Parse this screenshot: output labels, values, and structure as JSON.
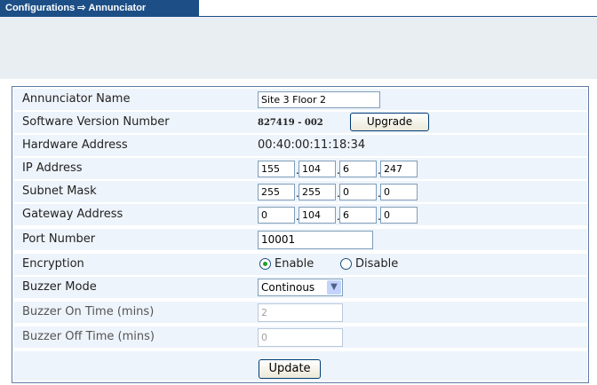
{
  "breadcrumb": {
    "section": "Configurations",
    "separator": "⇨",
    "page": "Annunciator"
  },
  "form": {
    "annunciator_name": {
      "label": "Annunciator Name",
      "value": "Site 3 Floor 2"
    },
    "software_version": {
      "label": "Software Version Number",
      "value": "827419 - 002",
      "button": "Upgrade"
    },
    "hardware_address": {
      "label": "Hardware Address",
      "value": "00:40:00:11:18:34"
    },
    "ip_address": {
      "label": "IP Address",
      "octets": [
        "155",
        "104",
        "6",
        "247"
      ]
    },
    "subnet_mask": {
      "label": "Subnet Mask",
      "octets": [
        "255",
        "255",
        "0",
        "0"
      ]
    },
    "gateway_address": {
      "label": "Gateway Address",
      "octets": [
        "0",
        "104",
        "6",
        "0"
      ]
    },
    "port_number": {
      "label": "Port Number",
      "value": "10001"
    },
    "encryption": {
      "label": "Encryption",
      "options": [
        "Enable",
        "Disable"
      ],
      "selected": "Enable"
    },
    "buzzer_mode": {
      "label": "Buzzer Mode",
      "value": "Continous"
    },
    "buzzer_on_time": {
      "label": "Buzzer On Time (mins)",
      "value": "2"
    },
    "buzzer_off_time": {
      "label": "Buzzer Off Time (mins)",
      "value": "0"
    },
    "update_button": "Update"
  },
  "colors": {
    "header": "#1d4f86",
    "row_background": "#eef4fb",
    "border": "#5f7ca1",
    "radio_selected": "#21a121"
  }
}
